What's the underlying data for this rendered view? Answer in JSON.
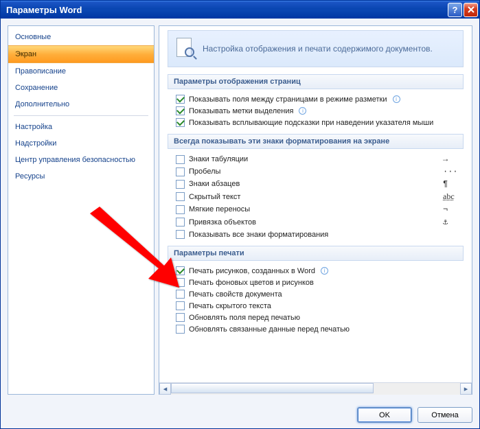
{
  "window": {
    "title": "Параметры Word"
  },
  "sidebar": {
    "items": [
      {
        "label": "Основные",
        "selected": false
      },
      {
        "label": "Экран",
        "selected": true
      },
      {
        "label": "Правописание",
        "selected": false
      },
      {
        "label": "Сохранение",
        "selected": false
      },
      {
        "label": "Дополнительно",
        "selected": false
      }
    ],
    "items2": [
      {
        "label": "Настройка",
        "selected": false
      },
      {
        "label": "Надстройки",
        "selected": false
      },
      {
        "label": "Центр управления безопасностью",
        "selected": false
      },
      {
        "label": "Ресурсы",
        "selected": false
      }
    ]
  },
  "banner": {
    "text": "Настройка отображения и печати содержимого документов."
  },
  "sections": {
    "display": {
      "title": "Параметры отображения страниц",
      "options": [
        {
          "checked": true,
          "label": "Показывать поля между страницами в режиме разметки",
          "info": true
        },
        {
          "checked": true,
          "label": "Показывать метки выделения",
          "info": true
        },
        {
          "checked": true,
          "label": "Показывать всплывающие подсказки при наведении указателя мыши",
          "info": false
        }
      ]
    },
    "marks": {
      "title": "Всегда показывать эти знаки форматирования на экране",
      "options": [
        {
          "checked": false,
          "label": "Знаки табуляции",
          "symbol": "→"
        },
        {
          "checked": false,
          "label": "Пробелы",
          "symbol": "···"
        },
        {
          "checked": false,
          "label": "Знаки абзацев",
          "symbol": "¶"
        },
        {
          "checked": false,
          "label": "Скрытый текст",
          "symbol": "abc"
        },
        {
          "checked": false,
          "label": "Мягкие переносы",
          "symbol": "¬"
        },
        {
          "checked": false,
          "label": "Привязка объектов",
          "symbol": "⚓"
        },
        {
          "checked": false,
          "label": "Показывать все знаки форматирования",
          "symbol": ""
        }
      ]
    },
    "print": {
      "title": "Параметры печати",
      "options": [
        {
          "checked": true,
          "label": "Печать рисунков, созданных в Word",
          "info": true
        },
        {
          "checked": false,
          "label": "Печать фоновых цветов и рисунков"
        },
        {
          "checked": false,
          "label": "Печать свойств документа"
        },
        {
          "checked": false,
          "label": "Печать скрытого текста"
        },
        {
          "checked": false,
          "label": "Обновлять поля перед печатью"
        },
        {
          "checked": false,
          "label": "Обновлять связанные данные перед печатью"
        }
      ]
    }
  },
  "footer": {
    "ok": "OK",
    "cancel": "Отмена"
  }
}
